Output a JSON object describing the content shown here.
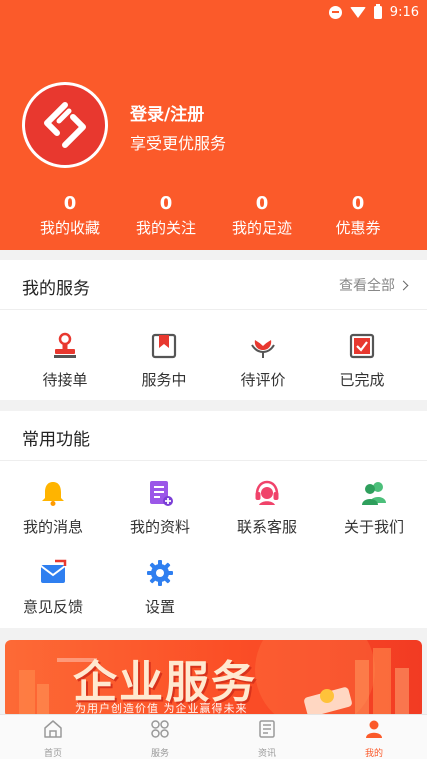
{
  "status_bar": {
    "time": "9:16"
  },
  "profile": {
    "login_label": "登录/注册",
    "subtitle": "享受更优服务"
  },
  "stats": [
    {
      "value": "0",
      "label": "我的收藏"
    },
    {
      "value": "0",
      "label": "我的关注"
    },
    {
      "value": "0",
      "label": "我的足迹"
    },
    {
      "value": "0",
      "label": "优惠券"
    }
  ],
  "services": {
    "title": "我的服务",
    "view_all": "查看全部",
    "items": [
      {
        "label": "待接单",
        "icon": "stamp-icon"
      },
      {
        "label": "服务中",
        "icon": "bookmark-icon"
      },
      {
        "label": "待评价",
        "icon": "flower-icon"
      },
      {
        "label": "已完成",
        "icon": "check-box-icon"
      }
    ]
  },
  "functions": {
    "title": "常用功能",
    "items": [
      {
        "label": "我的消息",
        "icon": "bell-icon"
      },
      {
        "label": "我的资料",
        "icon": "document-icon"
      },
      {
        "label": "联系客服",
        "icon": "headset-icon"
      },
      {
        "label": "关于我们",
        "icon": "people-icon"
      },
      {
        "label": "意见反馈",
        "icon": "mail-icon"
      },
      {
        "label": "设置",
        "icon": "gear-icon"
      }
    ]
  },
  "banner": {
    "title": "企业服务",
    "subtitle": "为用户创造价值  为企业赢得未来"
  },
  "tabbar": [
    {
      "label": "首页",
      "icon": "home-icon",
      "active": false
    },
    {
      "label": "服务",
      "icon": "grid-icon",
      "active": false
    },
    {
      "label": "资讯",
      "icon": "news-icon",
      "active": false
    },
    {
      "label": "我的",
      "icon": "user-icon",
      "active": true
    }
  ],
  "colors": {
    "primary": "#fb5a2a",
    "active_tab": "#fb5a2a",
    "inactive_tab": "#999999"
  }
}
